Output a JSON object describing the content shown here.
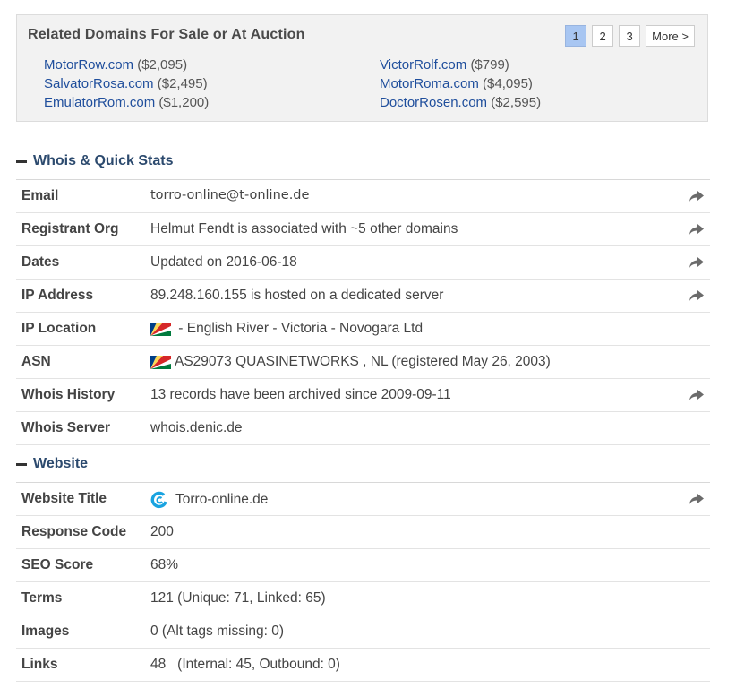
{
  "related": {
    "title": "Related Domains For Sale or At Auction",
    "pager": [
      "1",
      "2",
      "3",
      "More >"
    ],
    "domains": [
      {
        "name": "MotorRow.com",
        "price": "($2,095)"
      },
      {
        "name": "VictorRolf.com",
        "price": "($799)"
      },
      {
        "name": "SalvatorRosa.com",
        "price": "($2,495)"
      },
      {
        "name": "MotorRoma.com",
        "price": "($4,095)"
      },
      {
        "name": "EmulatorRom.com",
        "price": "($1,200)"
      },
      {
        "name": "DoctorRosen.com",
        "price": "($2,595)"
      }
    ]
  },
  "whois": {
    "title": "Whois & Quick Stats",
    "rows": [
      {
        "label": "Email",
        "value": "torro-online@t-online.de",
        "share": true
      },
      {
        "label": "Registrant Org",
        "value": "Helmut Fendt is associated with ~5 other domains",
        "share": true
      },
      {
        "label": "Dates",
        "value": "Updated on 2016-06-18",
        "share": true
      },
      {
        "label": "IP Address",
        "value": "89.248.160.155 is hosted on a dedicated server",
        "share": true
      },
      {
        "label": "IP Location",
        "value": " - English River - Victoria - Novogara Ltd",
        "flag": "seychelles-flag-icon"
      },
      {
        "label": "ASN",
        "value": "AS29073 QUASINETWORKS , NL (registered May 26, 2003)",
        "flag": "seychelles-flag-icon"
      },
      {
        "label": "Whois History",
        "value": "13 records have been archived since 2009-09-11",
        "share": true
      },
      {
        "label": "Whois Server",
        "value": "whois.denic.de"
      }
    ]
  },
  "website": {
    "title": "Website",
    "rows": [
      {
        "label": "Website Title",
        "value": "Torro-online.de",
        "favicon": "site-favicon-icon",
        "share": true
      },
      {
        "label": "Response Code",
        "value": "200"
      },
      {
        "label": "SEO Score",
        "value": "68%"
      },
      {
        "label": "Terms",
        "value": "121 (Unique: 71, Linked: 65)"
      },
      {
        "label": "Images",
        "value": "0 (Alt tags missing: 0)"
      },
      {
        "label": "Links",
        "value": "48   (Internal: 45, Outbound: 0)"
      }
    ]
  },
  "colors": {
    "link": "#1f4e9c",
    "section_heading": "#2c4a6e",
    "pager_active": "#a8c6f2"
  },
  "icons": {
    "share": "share-arrow-icon",
    "collapse": "minus-icon"
  }
}
